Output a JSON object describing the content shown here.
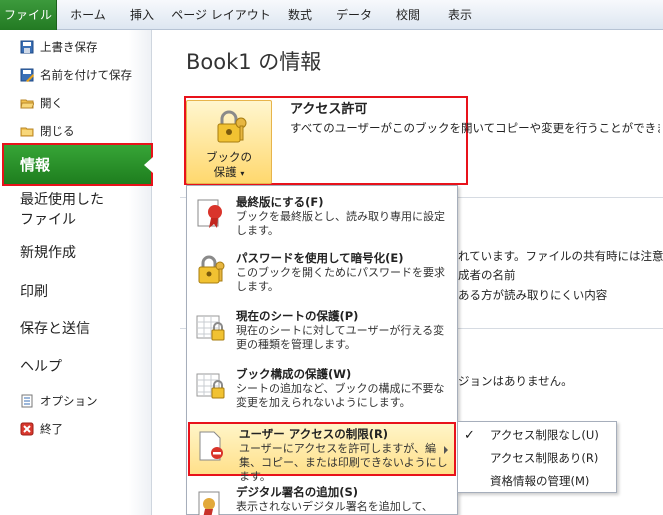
{
  "ribbon": {
    "tabs": [
      "ファイル",
      "ホーム",
      "挿入",
      "ページ レイアウト",
      "数式",
      "データ",
      "校閲",
      "表示"
    ]
  },
  "leftnav": {
    "small_top": [
      {
        "label": "上書き保存",
        "icon": "save-icon"
      },
      {
        "label": "名前を付けて保存",
        "icon": "save-as-icon"
      },
      {
        "label": "開く",
        "icon": "open-folder-icon"
      },
      {
        "label": "閉じる",
        "icon": "close-folder-icon"
      }
    ],
    "active": "情報",
    "big": [
      "最近使用した",
      "ファイル",
      "新規作成",
      "印刷",
      "保存と送信",
      "ヘルプ"
    ],
    "small_bottom": [
      {
        "label": "オプション",
        "icon": "options-icon"
      },
      {
        "label": "終了",
        "icon": "exit-icon"
      }
    ]
  },
  "main": {
    "title": "Book1 の情報",
    "permission": {
      "button_line1": "ブックの",
      "button_line2": "保護",
      "title": "アクセス許可",
      "desc": "すべてのユーザーがこのブックを開いてコピーや変更を行うことができます。"
    },
    "background_lines": [
      "れています。ファイルの共有時には注意して",
      "成者の名前",
      "ある方が読み取りにくい内容",
      "ジョンはありません。"
    ]
  },
  "protect_menu": {
    "items": [
      {
        "title": "最終版にする(F)",
        "desc": "ブックを最終版とし、読み取り専用に設定します。",
        "icon": "final-ribbon-icon"
      },
      {
        "title": "パスワードを使用して暗号化(E)",
        "desc": "このブックを開くためにパスワードを要求します。",
        "icon": "lock-key-icon"
      },
      {
        "title": "現在のシートの保護(P)",
        "desc": "現在のシートに対してユーザーが行える変更の種類を管理します。",
        "icon": "sheet-lock-icon"
      },
      {
        "title": "ブック構成の保護(W)",
        "desc": "シートの追加など、ブックの構成に不要な変更を加えられないようにします。",
        "icon": "workbook-lock-icon"
      },
      {
        "title": "ユーザー アクセスの制限(R)",
        "desc": "ユーザーにアクセスを許可しますが、編集、コピー、または印刷できないようにします。",
        "icon": "restrict-access-icon"
      },
      {
        "title": "デジタル署名の追加(S)",
        "desc": "表示されないデジタル署名を追加して、",
        "icon": "signature-icon"
      }
    ]
  },
  "submenu": {
    "items": [
      "アクセス制限なし(U)",
      "アクセス制限あり(R)",
      "資格情報の管理(M)"
    ],
    "checked_index": 0
  },
  "colors": {
    "file_tab": "#2d8b2d",
    "highlight_border": "#e8121b",
    "menu_highlight": "#ffe08a"
  }
}
